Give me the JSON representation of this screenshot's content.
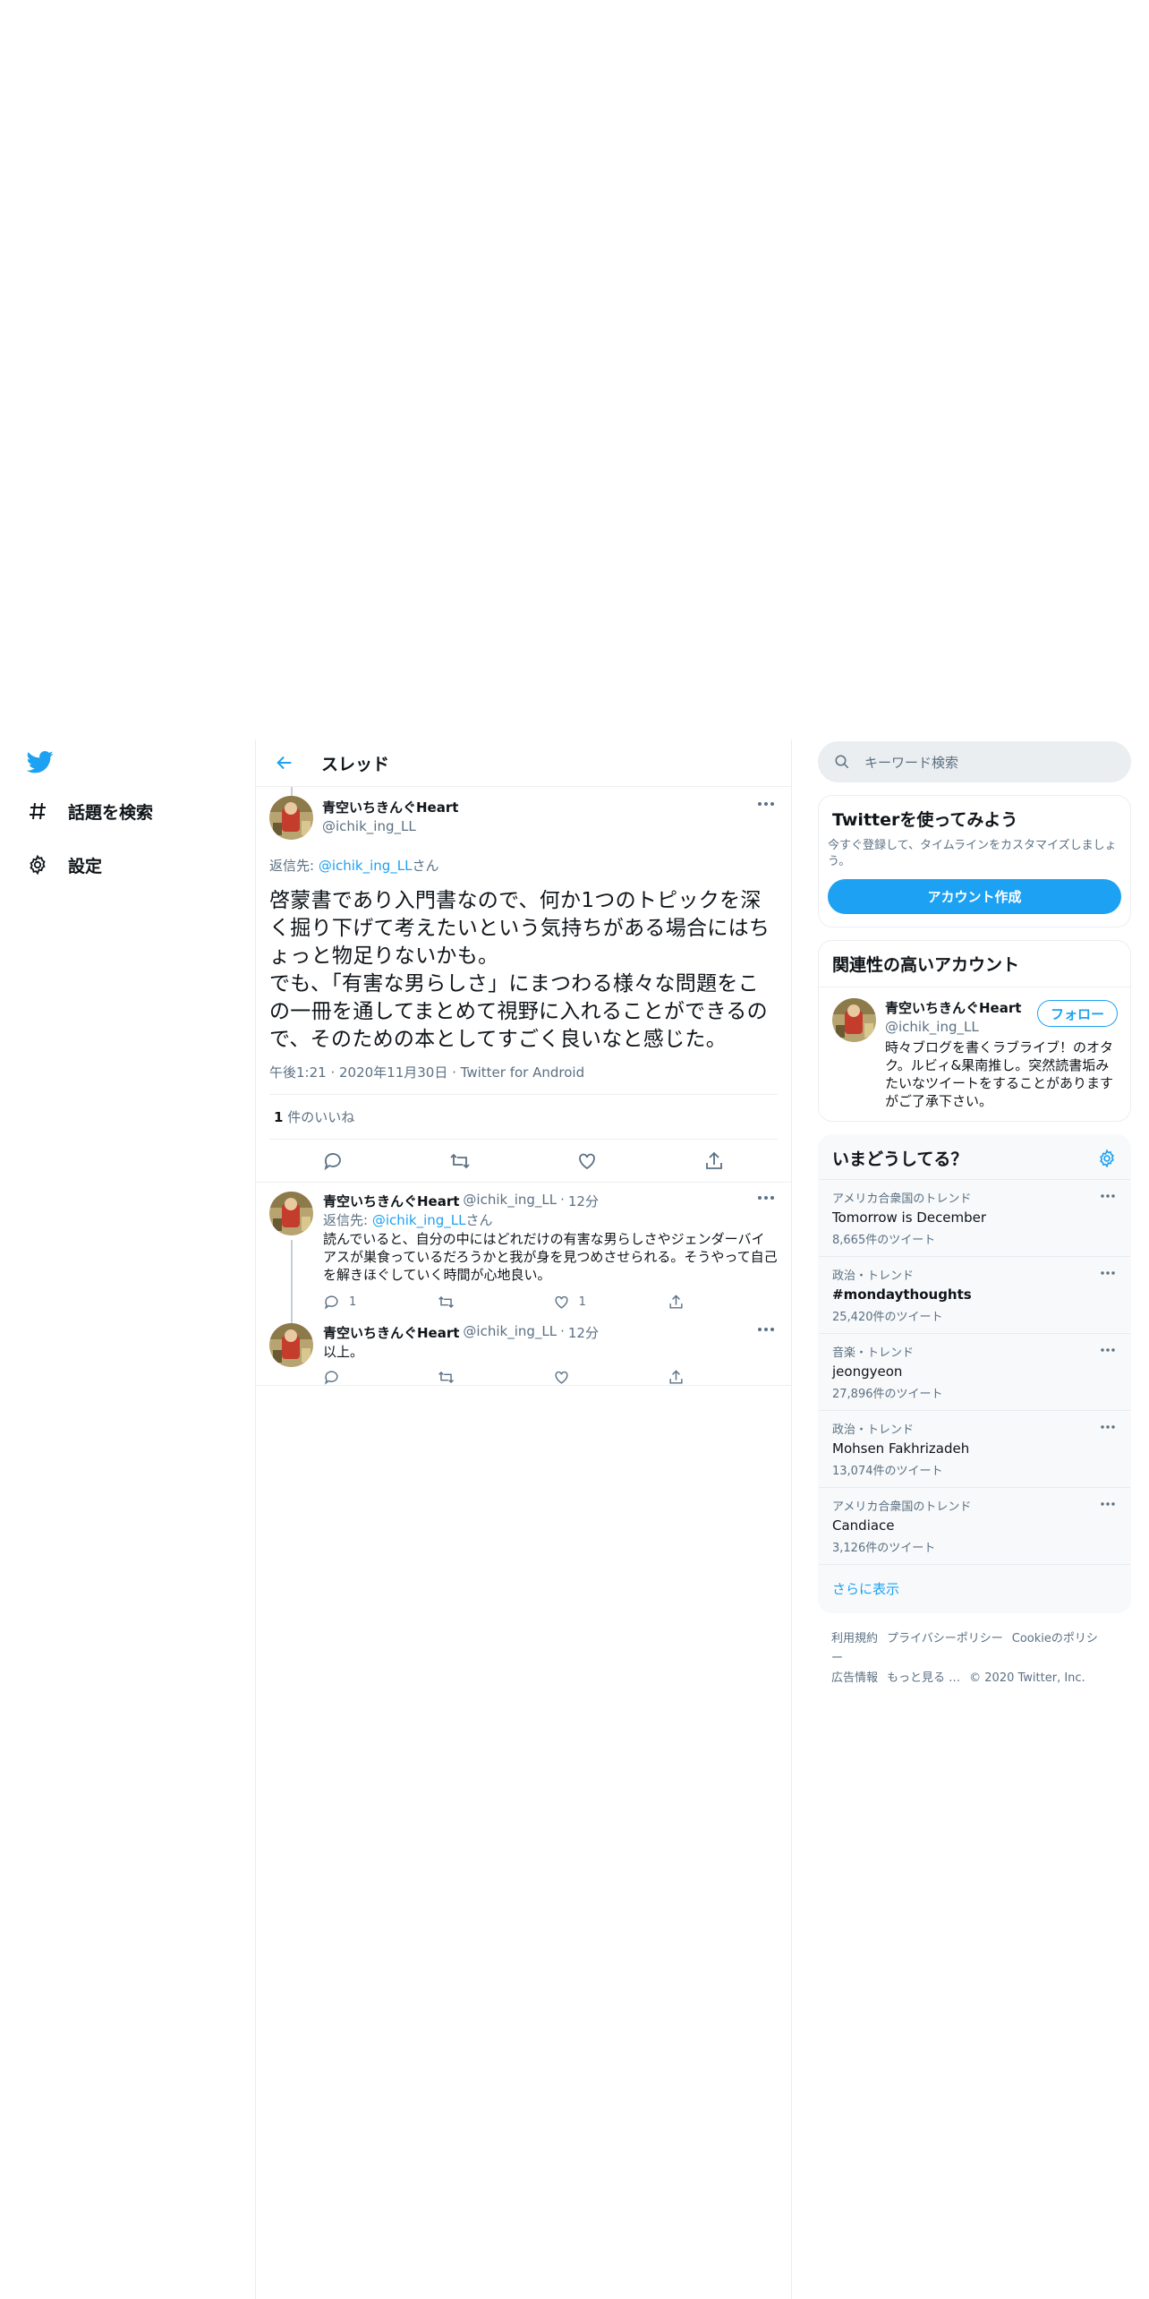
{
  "nav": {
    "items": [
      {
        "label": "話題を検索",
        "icon": "hashtag-icon"
      },
      {
        "label": "設定",
        "icon": "gear-icon"
      }
    ]
  },
  "header": {
    "title": "スレッド"
  },
  "focus_tweet": {
    "display_name": "青空いちきんぐHeart",
    "handle": "@ichik_ing_LL",
    "reply_prefix": "返信先: ",
    "reply_handle": "@ichik_ing_LL",
    "reply_suffix": "さん",
    "text": "啓蒙書であり入門書なので、何か1つのトピックを深く掘り下げて考えたいという気持ちがある場合にはちょっと物足りないかも。\nでも、「有害な男らしさ」にまつわる様々な問題をこの一冊を通してまとめて視野に入れることができるので、そのための本としてすごく良いなと感じた。",
    "time": "午後1:21",
    "date": "2020年11月30日",
    "source": "Twitter for Android",
    "like_count": "1",
    "like_label": "件のいいね"
  },
  "replies": [
    {
      "display_name": "青空いちきんぐHeart",
      "handle": "@ichik_ing_LL",
      "age": "12分",
      "reply_prefix": "返信先: ",
      "reply_handle": "@ichik_ing_LL",
      "reply_suffix": "さん",
      "text": "読んでいると、自分の中にはどれだけの有害な男らしさやジェンダーバイアスが巣食っているだろうかと我が身を見つめさせられる。そうやって自己を解きほぐしていく時間が心地良い。",
      "reply_count": "1",
      "retweet_count": "",
      "like_count": "1"
    },
    {
      "display_name": "青空いちきんぐHeart",
      "handle": "@ichik_ing_LL",
      "age": "12分",
      "text": "以上。",
      "reply_count": "",
      "retweet_count": "",
      "like_count": ""
    }
  ],
  "right": {
    "search_placeholder": "キーワード検索",
    "signup": {
      "title": "Twitterを使ってみよう",
      "desc": "今すぐ登録して、タイムラインをカスタマイズしましょう。",
      "button": "アカウント作成"
    },
    "related": {
      "title": "関連性の高いアカウント",
      "display_name": "青空いちきんぐHeart",
      "handle": "@ichik_ing_LL",
      "follow": "フォロー",
      "bio": "時々ブログを書くラブライブ！のオタク。ルビィ&果南推し。突然読書垢みたいなツイートをすることがありますがご了承下さい。"
    },
    "trends": {
      "title": "いまどうしてる？",
      "items": [
        {
          "context": "アメリカ合衆国のトレンド",
          "name": "Tomorrow is December",
          "count": "8,665件のツイート",
          "bold": false
        },
        {
          "context": "政治・トレンド",
          "name": "#mondaythoughts",
          "count": "25,420件のツイート",
          "bold": true
        },
        {
          "context": "音楽・トレンド",
          "name": "jeongyeon",
          "count": "27,896件のツイート",
          "bold": false
        },
        {
          "context": "政治・トレンド",
          "name": "Mohsen Fakhrizadeh",
          "count": "13,074件のツイート",
          "bold": false
        },
        {
          "context": "アメリカ合衆国のトレンド",
          "name": "Candiace",
          "count": "3,126件のツイート",
          "bold": false
        }
      ],
      "show_more": "さらに表示"
    },
    "footer": {
      "links": [
        "利用規約",
        "プライバシーポリシー",
        "Cookieのポリシー",
        "広告情報",
        "もっと見る …"
      ],
      "copyright": "© 2020 Twitter, Inc."
    }
  },
  "colors": {
    "accent": "#1da1f2",
    "muted": "#5b7083",
    "border": "#ebeef0"
  }
}
